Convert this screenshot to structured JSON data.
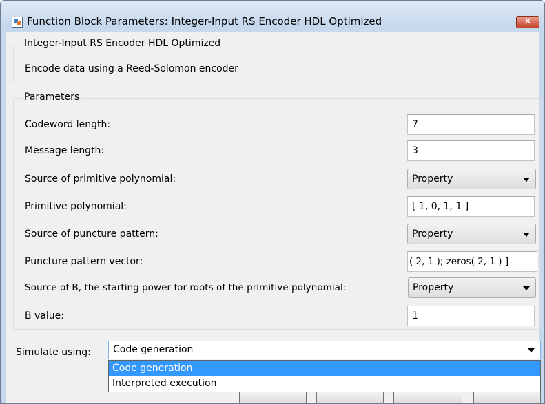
{
  "window": {
    "title": "Function Block Parameters: Integer-Input RS Encoder HDL Optimized",
    "close_label": "✕"
  },
  "block": {
    "name": "Integer-Input RS Encoder HDL Optimized",
    "description": "Encode data using a Reed-Solomon encoder"
  },
  "parameters": {
    "legend": "Parameters",
    "codeword_length": {
      "label": "Codeword length:",
      "value": "7"
    },
    "message_length": {
      "label": "Message length:",
      "value": "3"
    },
    "source_primitive_polynomial": {
      "label": "Source of primitive polynomial:",
      "value": "Property"
    },
    "primitive_polynomial": {
      "label": "Primitive polynomial:",
      "value": "[ 1, 0, 1, 1 ]"
    },
    "source_puncture_pattern": {
      "label": "Source of puncture pattern:",
      "value": "Property"
    },
    "puncture_pattern_vector": {
      "label": "Puncture pattern vector:",
      "value": "( 2, 1 ); zeros( 2, 1 ) ]"
    },
    "source_b": {
      "label": "Source of B, the starting power for roots of the primitive polynomial:",
      "value": "Property"
    },
    "b_value": {
      "label": "B value:",
      "value": "1"
    }
  },
  "simulate": {
    "label": "Simulate using:",
    "value": "Code generation",
    "options": [
      "Code generation",
      "Interpreted execution"
    ]
  },
  "colors": {
    "selection": "#3399ff",
    "close_button": "#c5442c",
    "dropdown_focus_border": "#7eb4ea"
  }
}
